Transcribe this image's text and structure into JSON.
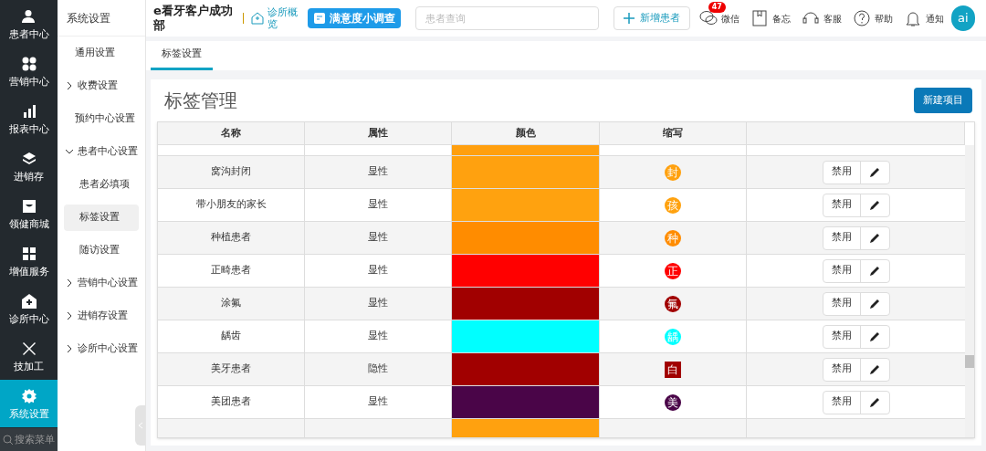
{
  "nav": [
    {
      "label": "患者中心",
      "selected": false
    },
    {
      "label": "营销中心",
      "selected": false
    },
    {
      "label": "报表中心",
      "selected": false
    },
    {
      "label": "进销存",
      "selected": false
    },
    {
      "label": "领健商城",
      "selected": false
    },
    {
      "label": "增值服务",
      "selected": false
    },
    {
      "label": "诊所中心",
      "selected": false
    },
    {
      "label": "技加工",
      "selected": false
    },
    {
      "label": "系统设置",
      "selected": true
    }
  ],
  "nav_search": {
    "placeholder": "搜索菜单"
  },
  "menu": {
    "title": "系统设置",
    "items": [
      {
        "kind": "link",
        "label": "通用设置",
        "selected": false
      },
      {
        "kind": "group",
        "label": "收费设置",
        "expanded": false
      },
      {
        "kind": "link",
        "label": "预约中心设置",
        "selected": false
      },
      {
        "kind": "group",
        "label": "患者中心设置",
        "expanded": true,
        "children": [
          {
            "label": "患者必填项",
            "selected": false
          },
          {
            "label": "标签设置",
            "selected": true
          },
          {
            "label": "随访设置",
            "selected": false
          }
        ]
      },
      {
        "kind": "group",
        "label": "营销中心设置",
        "expanded": false
      },
      {
        "kind": "group",
        "label": "进销存设置",
        "expanded": false
      },
      {
        "kind": "group",
        "label": "诊所中心设置",
        "expanded": false
      }
    ]
  },
  "header": {
    "clinic": "e看牙客户成功部",
    "overview": "诊所概览",
    "survey": "满意度小调查",
    "search": {
      "placeholder": "患者查询"
    },
    "new_patient": "新增患者",
    "tools": [
      {
        "label": "微信",
        "badge": "47"
      },
      {
        "label": "备忘"
      },
      {
        "label": "客服"
      },
      {
        "label": "帮助"
      },
      {
        "label": "通知"
      }
    ],
    "avatar": "ai"
  },
  "tabs": [
    {
      "label": "标签设置",
      "selected": true
    }
  ],
  "page": {
    "title": "标签管理",
    "new_button": "新建项目"
  },
  "table": {
    "columns": [
      "名称",
      "属性",
      "颜色",
      "缩写"
    ],
    "rows": [
      {
        "kind": "partial",
        "color": "#ff9f0e"
      },
      {
        "kind": "circle",
        "name": "窝沟封闭",
        "attr": "显性",
        "color": "#ffa10f",
        "abbr": "封",
        "action": "禁用"
      },
      {
        "kind": "circle",
        "name": "带小朋友的家长",
        "attr": "显性",
        "color": "#ffa20f",
        "abbr": "孩",
        "action": "禁用"
      },
      {
        "kind": "circle",
        "name": "种植患者",
        "attr": "显性",
        "color": "#ff8c00",
        "abbr": "种",
        "action": "禁用"
      },
      {
        "kind": "circle",
        "name": "正畸患者",
        "attr": "显性",
        "color": "#ff0000",
        "abbr": "正",
        "action": "禁用"
      },
      {
        "kind": "circle",
        "name": "涂氟",
        "attr": "显性",
        "color": "#a10000",
        "abbr": "氟",
        "action": "禁用"
      },
      {
        "kind": "circle",
        "name": "龋齿",
        "attr": "显性",
        "color": "#00ffff",
        "abbr": "龋",
        "action": "禁用"
      },
      {
        "kind": "square",
        "name": "美牙患者",
        "attr": "隐性",
        "color": "#a10000",
        "abbr": "白",
        "action": "禁用"
      },
      {
        "kind": "circle",
        "name": "美团患者",
        "attr": "显性",
        "color": "#4a0548",
        "abbr": "美",
        "action": "禁用"
      },
      {
        "kind": "partial",
        "color": "#ffa10f"
      }
    ]
  }
}
